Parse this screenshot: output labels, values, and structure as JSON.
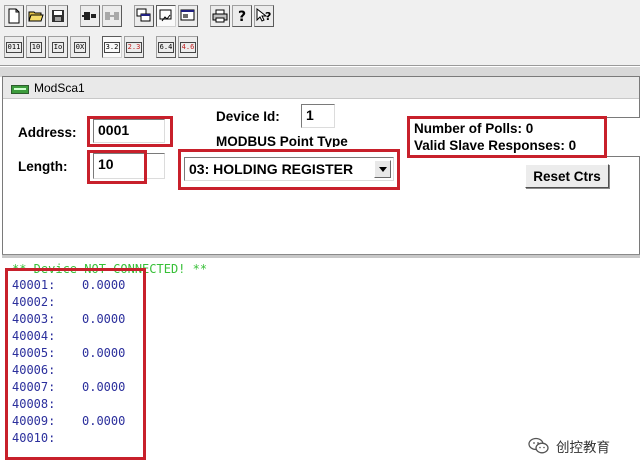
{
  "toolbar": {
    "row1": [
      {
        "name": "new-document-icon"
      },
      {
        "name": "open-folder-icon"
      },
      {
        "name": "save-disk-icon"
      },
      {
        "name": "connect-icon"
      },
      {
        "name": "disconnect-icon"
      },
      {
        "name": "tile-windows-icon"
      },
      {
        "name": "view-icon"
      },
      {
        "name": "display-icon"
      },
      {
        "name": "print-icon"
      },
      {
        "name": "help-question-icon"
      },
      {
        "name": "context-help-icon"
      }
    ],
    "row2": [
      {
        "name": "format-011-button",
        "label": "011"
      },
      {
        "name": "format-10-button",
        "label": "10"
      },
      {
        "name": "format-io-button",
        "label": "Io"
      },
      {
        "name": "format-0x-button",
        "label": "0X"
      },
      {
        "name": "format-32-button",
        "label": "3.2"
      },
      {
        "name": "format-23-button",
        "label": "2.3"
      },
      {
        "name": "format-64-button",
        "label": "6.4"
      },
      {
        "name": "format-46-button",
        "label": "4.6"
      }
    ]
  },
  "window": {
    "title": "ModSca1"
  },
  "controls": {
    "address_label": "Address:",
    "address_value": "0001",
    "device_id_label": "Device Id:",
    "device_id_value": "1",
    "point_type_label": "MODBUS Point Type",
    "length_label": "Length:",
    "length_value": "10",
    "point_type_value": "03: HOLDING REGISTER",
    "polls_label": "Number of Polls: 0",
    "responses_label": "Valid Slave Responses: 0",
    "reset_button": "Reset Ctrs"
  },
  "data": {
    "status": "** Device NOT CONNECTED! **",
    "registers": [
      {
        "address": "40001:",
        "value": "0.0000"
      },
      {
        "address": "40002:",
        "value": ""
      },
      {
        "address": "40003:",
        "value": "0.0000"
      },
      {
        "address": "40004:",
        "value": ""
      },
      {
        "address": "40005:",
        "value": "0.0000"
      },
      {
        "address": "40006:",
        "value": ""
      },
      {
        "address": "40007:",
        "value": "0.0000"
      },
      {
        "address": "40008:",
        "value": ""
      },
      {
        "address": "40009:",
        "value": "0.0000"
      },
      {
        "address": "40010:",
        "value": ""
      }
    ]
  },
  "watermark": {
    "text": "创控教育",
    "icon": "wechat-logo-icon"
  },
  "colors": {
    "highlight_box": "#c8202b",
    "status_text": "#38c038",
    "register_text": "#2b2f9c"
  }
}
